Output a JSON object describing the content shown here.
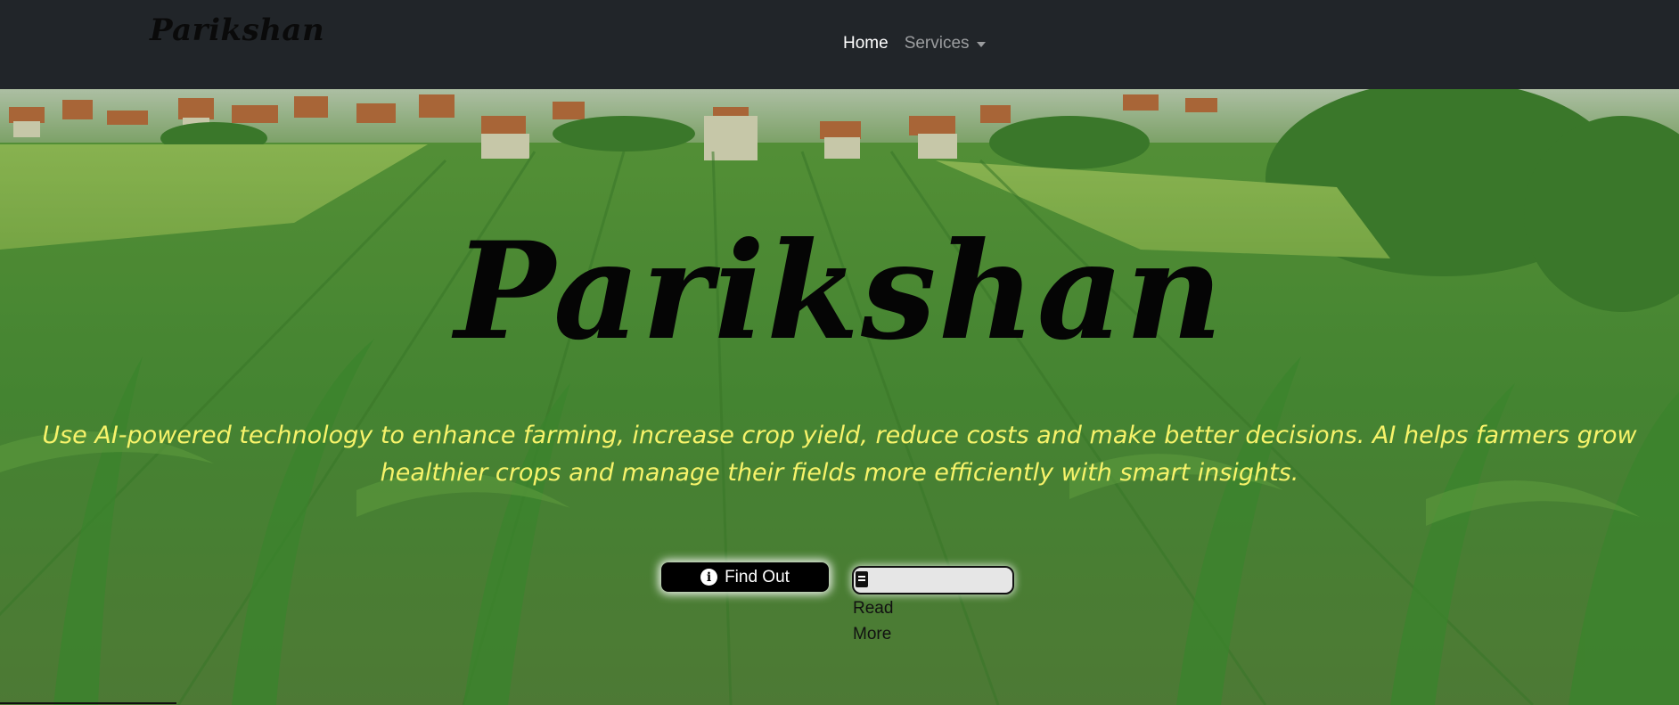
{
  "navbar": {
    "brand": "Parikshan",
    "links": {
      "home": "Home",
      "services": "Services"
    }
  },
  "hero": {
    "title": "Parikshan",
    "subtitle": "Use AI-powered technology to enhance farming, increase crop yield, reduce costs and make better decisions. AI helps farmers grow healthier crops and manage their fields more efficiently with smart insights.",
    "buttons": {
      "find_out": "Find Out",
      "read_more": "Read More"
    }
  },
  "colors": {
    "navbar_bg": "#212529",
    "subtitle_color": "#f7f36a",
    "hero_green": "#4f8a37"
  },
  "icons": {
    "find_out": "info-icon",
    "read_more": "book-icon",
    "services": "caret-down-icon"
  }
}
